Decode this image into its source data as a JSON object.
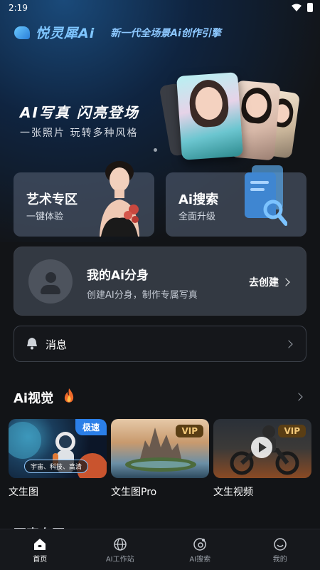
{
  "status": {
    "time": "2:19"
  },
  "brand": {
    "name": "悦灵犀Ai",
    "slogan": "新一代全场景Ai创作引擎"
  },
  "hero": {
    "title": "AI写真  闪亮登场",
    "subtitle": "一张照片  玩转多种风格"
  },
  "cards": [
    {
      "title": "艺术专区",
      "subtitle": "一键体验"
    },
    {
      "title": "Ai搜索",
      "subtitle": "全面升级"
    }
  ],
  "avatar": {
    "title": "我的Ai分身",
    "subtitle": "创建AI分身，制作专属写真",
    "cta": "去创建"
  },
  "messages": {
    "label": "消息"
  },
  "section": {
    "title": "Ai视觉"
  },
  "thumbs": [
    {
      "label": "文生图",
      "badge": "极速",
      "tag": "宇宙、科技、高清"
    },
    {
      "label": "文生图Pro",
      "badge": "VIP"
    },
    {
      "label": "文生视频",
      "badge": "VIP"
    }
  ],
  "next_section": {
    "title": "写真专区"
  },
  "tabbar": [
    {
      "label": "首页",
      "icon": "home-icon",
      "active": true
    },
    {
      "label": "AI工作站",
      "icon": "globe-icon"
    },
    {
      "label": "AI搜索",
      "icon": "search-icon"
    },
    {
      "label": "我的",
      "icon": "smile-icon"
    }
  ],
  "colors": {
    "accent": "#2b7fe8",
    "brand": "#7fc6ff",
    "vip": "#f3c97a",
    "background": "#121417"
  }
}
